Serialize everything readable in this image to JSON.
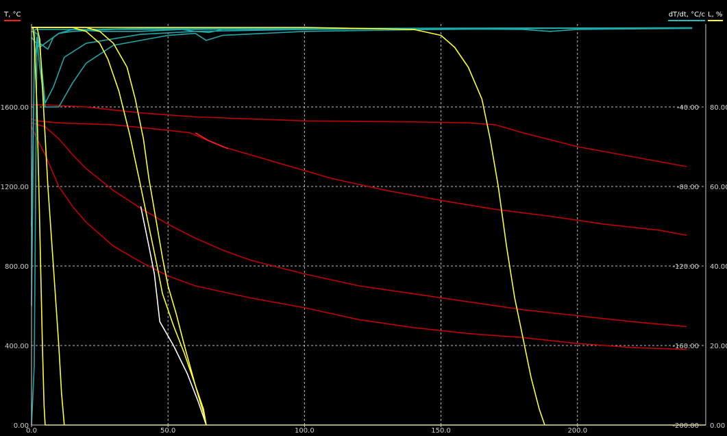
{
  "chart_data": {
    "type": "line",
    "left_axis": {
      "label": "T, °C",
      "color": "#ff2020",
      "range": [
        0,
        2000
      ],
      "ticks": [
        0,
        400,
        800,
        1200,
        1600
      ],
      "tick_labels": [
        "0.00",
        "400.00",
        "800.00",
        "1200.00",
        "1600.00"
      ]
    },
    "right_axis_1": {
      "label": "dT/dt, °C/c",
      "color": "#20c0c0",
      "range": [
        -200,
        0
      ],
      "ticks": [
        -40,
        -80,
        -120,
        -160,
        -200
      ],
      "tick_labels": [
        "-40.00",
        "-80.00",
        "-120.00",
        "-160.00",
        "-200.00"
      ]
    },
    "right_axis_2": {
      "label": "L, %",
      "color": "#ffff30",
      "range": [
        0,
        100
      ],
      "ticks": [
        0,
        20,
        40,
        60,
        80
      ],
      "tick_labels": [
        "0.00",
        "20.00",
        "40.00",
        "60.00",
        "80.00"
      ]
    },
    "x_axis": {
      "label": "",
      "range": [
        0,
        247
      ],
      "ticks": [
        0,
        50,
        100,
        150,
        200
      ],
      "tick_labels": [
        "0.0",
        "50.0",
        "100.0",
        "150.0",
        "200.0"
      ]
    },
    "grid": true,
    "series": [
      {
        "axis": "T",
        "color": "#c00000",
        "points": [
          [
            0,
            1610
          ],
          [
            5,
            1610
          ],
          [
            20,
            1600
          ],
          [
            40,
            1570
          ],
          [
            60,
            1550
          ],
          [
            100,
            1530
          ],
          [
            140,
            1525
          ],
          [
            160,
            1520
          ],
          [
            170,
            1510
          ],
          [
            180,
            1470
          ],
          [
            200,
            1400
          ],
          [
            220,
            1350
          ],
          [
            240,
            1300
          ]
        ]
      },
      {
        "axis": "T",
        "color": "#c00000",
        "points": [
          [
            0,
            1540
          ],
          [
            2,
            1530
          ],
          [
            10,
            1520
          ],
          [
            30,
            1510
          ],
          [
            45,
            1490
          ],
          [
            58,
            1470
          ],
          [
            70,
            1400
          ],
          [
            90,
            1320
          ],
          [
            110,
            1240
          ],
          [
            130,
            1180
          ],
          [
            150,
            1130
          ],
          [
            170,
            1085
          ],
          [
            190,
            1050
          ],
          [
            210,
            1010
          ],
          [
            230,
            980
          ],
          [
            240,
            955
          ]
        ]
      },
      {
        "axis": "T",
        "color": "#ff2020",
        "points": [
          [
            60,
            1470
          ],
          [
            65,
            1430
          ],
          [
            72,
            1390
          ]
        ]
      },
      {
        "axis": "T",
        "color": "#c00000",
        "points": [
          [
            0,
            1520
          ],
          [
            5,
            1500
          ],
          [
            10,
            1440
          ],
          [
            15,
            1360
          ],
          [
            20,
            1290
          ],
          [
            30,
            1180
          ],
          [
            40,
            1090
          ],
          [
            50,
            1010
          ],
          [
            60,
            940
          ],
          [
            70,
            880
          ],
          [
            80,
            830
          ],
          [
            100,
            760
          ],
          [
            120,
            700
          ],
          [
            140,
            660
          ],
          [
            160,
            620
          ],
          [
            180,
            580
          ],
          [
            200,
            550
          ],
          [
            220,
            520
          ],
          [
            240,
            495
          ]
        ]
      },
      {
        "axis": "T",
        "color": "#c00000",
        "points": [
          [
            0,
            1500
          ],
          [
            2,
            1440
          ],
          [
            5,
            1360
          ],
          [
            10,
            1200
          ],
          [
            15,
            1100
          ],
          [
            20,
            1020
          ],
          [
            30,
            900
          ],
          [
            40,
            820
          ],
          [
            50,
            750
          ],
          [
            60,
            700
          ],
          [
            80,
            640
          ],
          [
            100,
            590
          ],
          [
            120,
            530
          ],
          [
            140,
            490
          ],
          [
            160,
            460
          ],
          [
            180,
            440
          ],
          [
            200,
            410
          ],
          [
            220,
            390
          ],
          [
            240,
            380
          ]
        ]
      },
      {
        "axis": "dT",
        "color": "#20a8a8",
        "points": [
          [
            0,
            -140
          ],
          [
            0.8,
            -40
          ],
          [
            1.2,
            -1
          ],
          [
            5,
            -1
          ],
          [
            10,
            -1
          ],
          [
            20,
            -1
          ],
          [
            40,
            -0.5
          ],
          [
            80,
            -0.5
          ],
          [
            120,
            -0.5
          ],
          [
            180,
            -0.3
          ],
          [
            242,
            -0.2
          ]
        ]
      },
      {
        "axis": "dT",
        "color": "#20a8a8",
        "points": [
          [
            0,
            -200
          ],
          [
            1,
            -170
          ],
          [
            1.5,
            -80
          ],
          [
            2,
            -5
          ],
          [
            3,
            -10
          ],
          [
            5,
            -38
          ],
          [
            8,
            -30
          ],
          [
            12,
            -15
          ],
          [
            20,
            -8
          ],
          [
            40,
            -3.5
          ],
          [
            60,
            -2
          ],
          [
            100,
            -1
          ],
          [
            150,
            -0.5
          ],
          [
            200,
            -0.3
          ],
          [
            242,
            -0.2
          ]
        ]
      },
      {
        "axis": "dT",
        "color": "#20a8a8",
        "points": [
          [
            0,
            -100
          ],
          [
            1,
            -20
          ],
          [
            2,
            -5
          ],
          [
            3,
            -20
          ],
          [
            5,
            -40
          ],
          [
            10,
            -40
          ],
          [
            15,
            -28
          ],
          [
            20,
            -18
          ],
          [
            30,
            -9
          ],
          [
            50,
            -4
          ],
          [
            60,
            -3
          ],
          [
            64,
            -6.5
          ],
          [
            70,
            -4
          ],
          [
            100,
            -2
          ],
          [
            150,
            -1
          ],
          [
            190,
            -0.5
          ],
          [
            242,
            -0.3
          ]
        ]
      },
      {
        "axis": "dT",
        "color": "#20a8a8",
        "points": [
          [
            0,
            -2
          ],
          [
            2,
            -3
          ],
          [
            3,
            -8
          ],
          [
            6,
            -11
          ],
          [
            8,
            -5
          ],
          [
            10,
            -3
          ],
          [
            15,
            -1
          ],
          [
            25,
            -2
          ],
          [
            40,
            -2
          ],
          [
            55,
            -1
          ],
          [
            60,
            -2
          ],
          [
            65,
            -2.5
          ],
          [
            70,
            -1
          ],
          [
            100,
            -1
          ],
          [
            130,
            -0.5
          ],
          [
            180,
            -1
          ],
          [
            190,
            -2
          ],
          [
            200,
            -1
          ],
          [
            242,
            -0.5
          ]
        ]
      },
      {
        "axis": "dT",
        "color": "#20a8a8",
        "points": [
          [
            0,
            -5
          ],
          [
            3,
            -10
          ],
          [
            5,
            -8
          ],
          [
            10,
            -3
          ],
          [
            15,
            -2
          ],
          [
            30,
            -1
          ],
          [
            60,
            -1
          ],
          [
            100,
            -0.5
          ],
          [
            200,
            -0.3
          ],
          [
            242,
            -0.3
          ]
        ]
      },
      {
        "axis": "L",
        "color": "#ffff30",
        "points": [
          [
            0,
            100
          ],
          [
            0.5,
            100
          ],
          [
            1,
            97
          ],
          [
            2,
            80
          ],
          [
            3,
            50
          ],
          [
            4,
            20
          ],
          [
            4.6,
            5
          ],
          [
            5,
            0
          ],
          [
            247,
            0
          ]
        ]
      },
      {
        "axis": "L",
        "color": "#ffff30",
        "points": [
          [
            0,
            100
          ],
          [
            2,
            100
          ],
          [
            3,
            97
          ],
          [
            4,
            85
          ],
          [
            6,
            60
          ],
          [
            8,
            40
          ],
          [
            10,
            20
          ],
          [
            11,
            8
          ],
          [
            12,
            0
          ]
        ]
      },
      {
        "axis": "L",
        "color": "#ffff30",
        "points": [
          [
            0,
            100
          ],
          [
            10,
            100
          ],
          [
            15,
            100
          ],
          [
            20,
            99
          ],
          [
            25,
            96
          ],
          [
            28,
            92
          ],
          [
            32,
            84
          ],
          [
            36,
            73
          ],
          [
            40,
            60
          ],
          [
            43,
            50
          ],
          [
            46,
            40
          ],
          [
            48,
            33
          ],
          [
            52,
            25
          ],
          [
            56,
            18
          ],
          [
            60,
            10
          ],
          [
            63,
            4
          ],
          [
            64,
            0
          ]
        ]
      },
      {
        "axis": "L",
        "color": "#ffffff",
        "points": [
          [
            40,
            55
          ],
          [
            43,
            45
          ],
          [
            45,
            38
          ],
          [
            47,
            26
          ],
          [
            52,
            20
          ],
          [
            57,
            13
          ],
          [
            61,
            6
          ],
          [
            63,
            2
          ],
          [
            64,
            0
          ]
        ]
      },
      {
        "axis": "L",
        "color": "#ffff30",
        "points": [
          [
            0,
            100
          ],
          [
            20,
            100
          ],
          [
            25,
            99
          ],
          [
            30,
            96
          ],
          [
            35,
            90
          ],
          [
            38,
            82
          ],
          [
            41,
            72
          ],
          [
            43,
            62
          ],
          [
            46,
            50
          ],
          [
            48,
            42
          ],
          [
            50,
            35
          ],
          [
            53,
            28
          ],
          [
            56,
            20
          ],
          [
            60,
            10
          ],
          [
            63,
            3
          ],
          [
            64,
            0
          ]
        ]
      },
      {
        "axis": "L",
        "color": "#ffff30",
        "points": [
          [
            0,
            100
          ],
          [
            100,
            100
          ],
          [
            140,
            99.5
          ],
          [
            150,
            98
          ],
          [
            155,
            95
          ],
          [
            160,
            90
          ],
          [
            165,
            82
          ],
          [
            168,
            72
          ],
          [
            171,
            60
          ],
          [
            174,
            45
          ],
          [
            177,
            32
          ],
          [
            180,
            22
          ],
          [
            183,
            12
          ],
          [
            186,
            4
          ],
          [
            188,
            0
          ]
        ]
      }
    ]
  }
}
